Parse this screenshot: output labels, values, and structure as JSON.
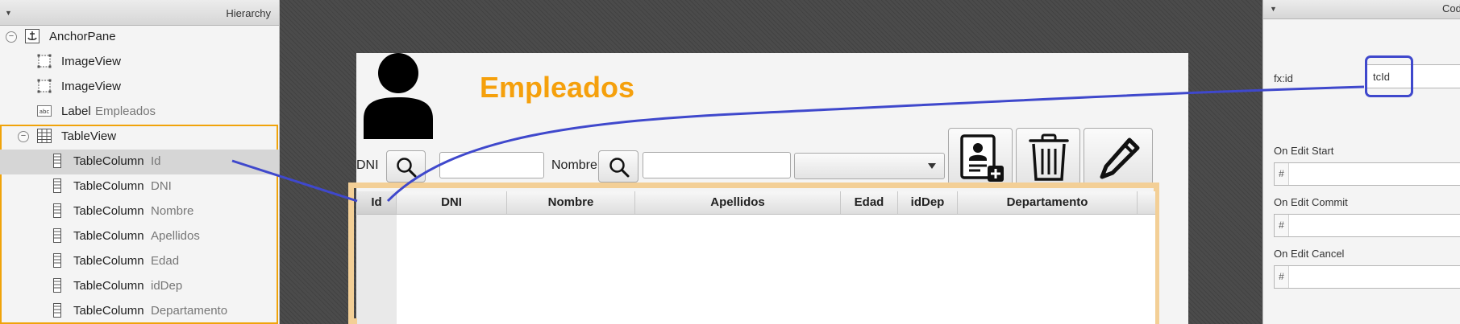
{
  "hierarchy": {
    "title": "Hierarchy",
    "nodes": [
      {
        "type": "AnchorPane",
        "id": ""
      },
      {
        "type": "ImageView",
        "id": ""
      },
      {
        "type": "ImageView",
        "id": ""
      },
      {
        "type": "Label",
        "id": "Empleados"
      },
      {
        "type": "TableView",
        "id": ""
      },
      {
        "type": "TableColumn",
        "id": "Id"
      },
      {
        "type": "TableColumn",
        "id": "DNI"
      },
      {
        "type": "TableColumn",
        "id": "Nombre"
      },
      {
        "type": "TableColumn",
        "id": "Apellidos"
      },
      {
        "type": "TableColumn",
        "id": "Edad"
      },
      {
        "type": "TableColumn",
        "id": "idDep"
      },
      {
        "type": "TableColumn",
        "id": "Departamento"
      }
    ],
    "collapse_glyph": "−"
  },
  "form": {
    "title": "Empleados",
    "title_color": "#f5a00c",
    "dni_label": "DNI",
    "nombre_label": "Nombre",
    "dni_value": "",
    "nombre_value": "",
    "combo_value": "",
    "icons": [
      "user-avatar-icon",
      "search-icon",
      "add-contact-icon",
      "trash-icon",
      "pencil-icon"
    ],
    "table": {
      "columns": [
        "Id",
        "DNI",
        "Nombre",
        "Apellidos",
        "Edad",
        "idDep",
        "Departamento"
      ],
      "rows": []
    }
  },
  "code_panel": {
    "title": "Code",
    "fx_id_label": "fx:id",
    "fx_id_value": "tcId",
    "on_edit_start_label": "On Edit Start",
    "on_edit_commit_label": "On Edit Commit",
    "on_edit_cancel_label": "On Edit Cancel",
    "hash": "#"
  },
  "accent_colors": {
    "selection_orange": "#f0a30a",
    "connector_blue": "#3f48cc"
  }
}
